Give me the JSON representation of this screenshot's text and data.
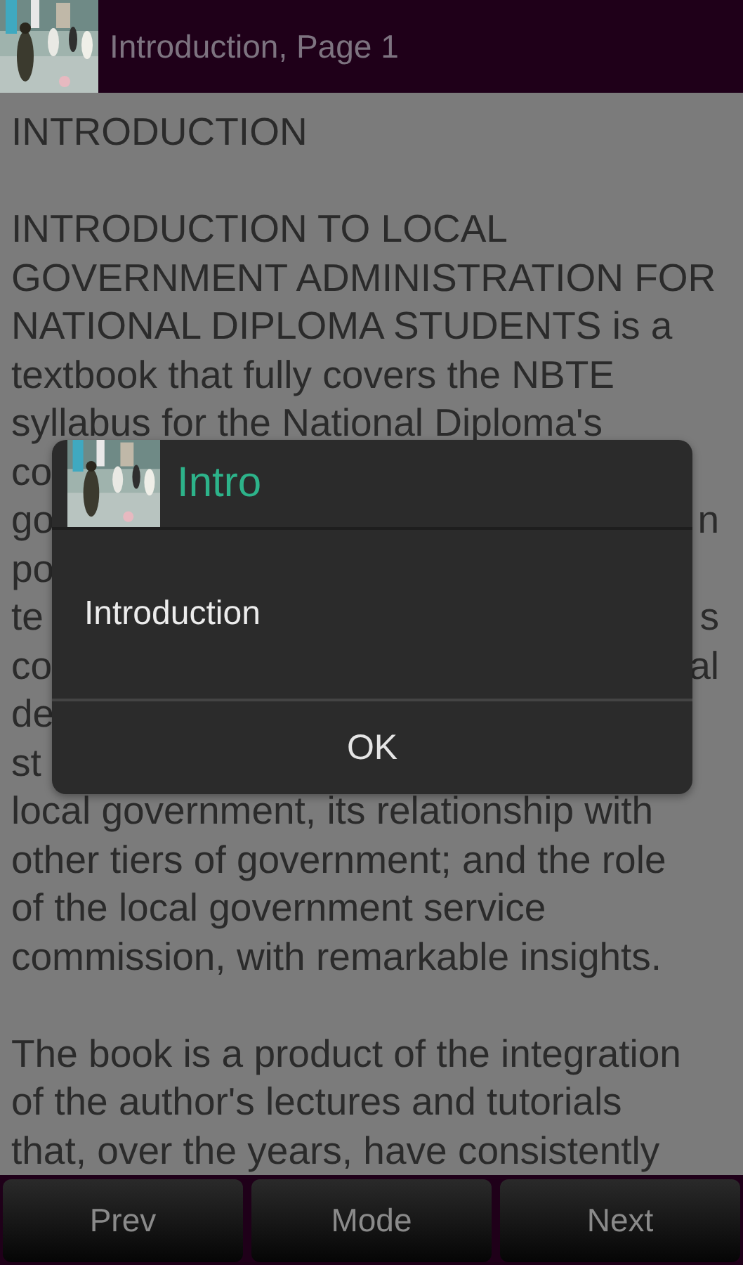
{
  "header": {
    "title": "Introduction, Page 1"
  },
  "content": {
    "heading": "INTRODUCTION",
    "lines": [
      {
        "kind": "gap"
      },
      {
        "kind": "text",
        "text": "INTRODUCTION TO LOCAL"
      },
      {
        "kind": "text",
        "text": "GOVERNMENT ADMINISTRATION FOR"
      },
      {
        "kind": "text",
        "text": "NATIONAL DIPLOMA STUDENTS is a"
      },
      {
        "kind": "text",
        "text": "textbook that fully covers the NBTE"
      },
      {
        "kind": "text",
        "text": "syllabus for the National Diploma's"
      },
      {
        "kind": "split",
        "left": "co"
      },
      {
        "kind": "split",
        "left": "go",
        "right": "n"
      },
      {
        "kind": "split",
        "left": "po"
      },
      {
        "kind": "split",
        "left": "te",
        "right": "s"
      },
      {
        "kind": "split",
        "left": "co",
        "right": "al"
      },
      {
        "kind": "split",
        "left": "de"
      },
      {
        "kind": "split",
        "left": "st"
      },
      {
        "kind": "text",
        "text": "local government, its relationship with"
      },
      {
        "kind": "text",
        "text": "other tiers of government; and the role"
      },
      {
        "kind": "text",
        "text": "of the local government service"
      },
      {
        "kind": "text",
        "text": "commission, with remarkable insights."
      },
      {
        "kind": "gap"
      },
      {
        "kind": "text",
        "text": "The book is a product of the integration"
      },
      {
        "kind": "text",
        "text": "of the author's lectures and tutorials"
      },
      {
        "kind": "text",
        "text": "that, over the years, have consistently"
      }
    ]
  },
  "dialog": {
    "title": "Intro",
    "message": "Introduction",
    "button": "OK"
  },
  "bottom_bar": {
    "buttons": [
      "Prev",
      "Mode",
      "Next"
    ]
  }
}
